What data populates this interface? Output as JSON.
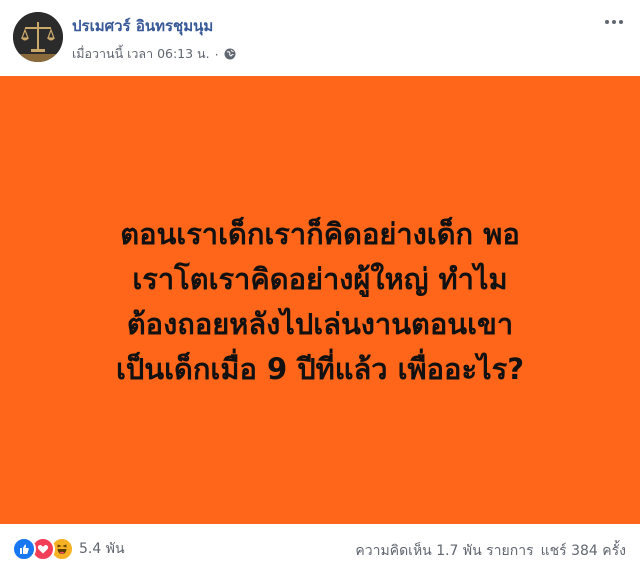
{
  "post": {
    "author": "ปรเมศวร์ อินทรชุมนุม",
    "timestamp": "เมื่อวานนี้ เวลา 06:13 น.",
    "separator": "·",
    "privacy_icon": "globe-icon",
    "more_icon": "more-options-icon"
  },
  "image": {
    "background_color": "#ff6619",
    "text_color": "#111111",
    "lines": [
      "ตอนเราเด็กเราก็คิดอย่างเด็ก พอ",
      "เราโตเราคิดอย่างผู้ใหญ่ ทำไม",
      "ต้องถอยหลังไปเล่นงานตอนเขา",
      "เป็นเด็กเมื่อ 9 ปีที่แล้ว เพื่ออะไร?"
    ]
  },
  "footer": {
    "reaction_icons": [
      "like-icon",
      "love-icon",
      "haha-icon"
    ],
    "reaction_count": "5.4 พัน",
    "comments": "ความคิดเห็น 1.7 พัน รายการ",
    "shares": "แชร์ 384 ครั้ง"
  },
  "colors": {
    "name": "#385898",
    "meta": "#616770",
    "like": "#1877f2",
    "love": "#f33e58",
    "haha": "#f7b125"
  }
}
